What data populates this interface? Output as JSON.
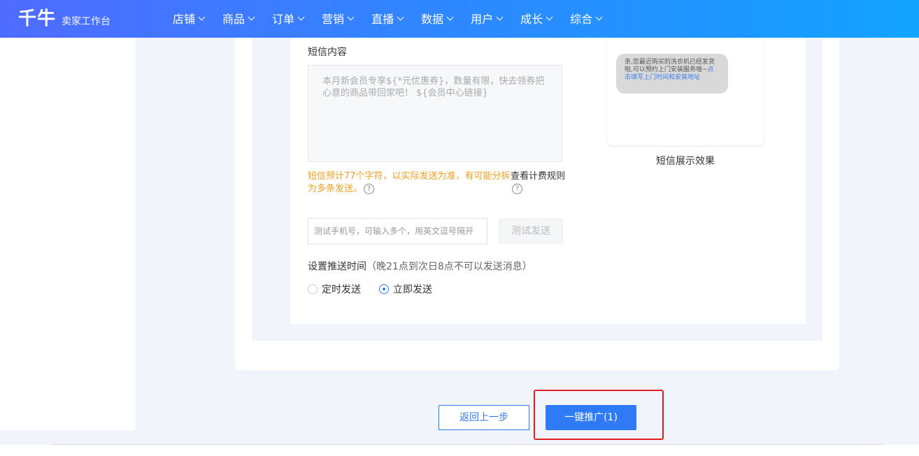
{
  "header": {
    "logo": "千牛",
    "subtitle": "卖家工作台",
    "nav": [
      {
        "label": "店铺"
      },
      {
        "label": "商品"
      },
      {
        "label": "订单"
      },
      {
        "label": "营销"
      },
      {
        "label": "直播"
      },
      {
        "label": "数据"
      },
      {
        "label": "用户"
      },
      {
        "label": "成长"
      },
      {
        "label": "综合"
      }
    ]
  },
  "sms": {
    "label": "短信内容",
    "content": "本月新会员专享${*元优惠券}，数量有限，快去领券把心意的商品带回家吧！ ${会员中心链接}",
    "tip_warning": "短信预计77个字符，以实际发送为准，有可能分拆为多条发送。",
    "tip_fee": "查看计费规则",
    "test_phone_placeholder": "测试手机号，可输入多个，用英文逗号隔开",
    "test_send": "测试发送"
  },
  "schedule": {
    "label": "设置推送时间",
    "hint": "（晚21点到次日8点不可以发送消息）",
    "options": [
      {
        "label": "定时发送",
        "selected": false
      },
      {
        "label": "立即发送",
        "selected": true
      }
    ]
  },
  "preview": {
    "bubble_text": "亲,您最近购买的洗衣机已经发货啦,可以预约上门安装服务哦~",
    "bubble_link": "点击填写上门时间和安装地址",
    "caption": "短信展示效果"
  },
  "footer": {
    "back": "返回上一步",
    "promote": "一键推广(1)"
  },
  "colors": {
    "accent": "#2f7bf5",
    "warning": "#f0a020",
    "highlight": "#e02020"
  }
}
